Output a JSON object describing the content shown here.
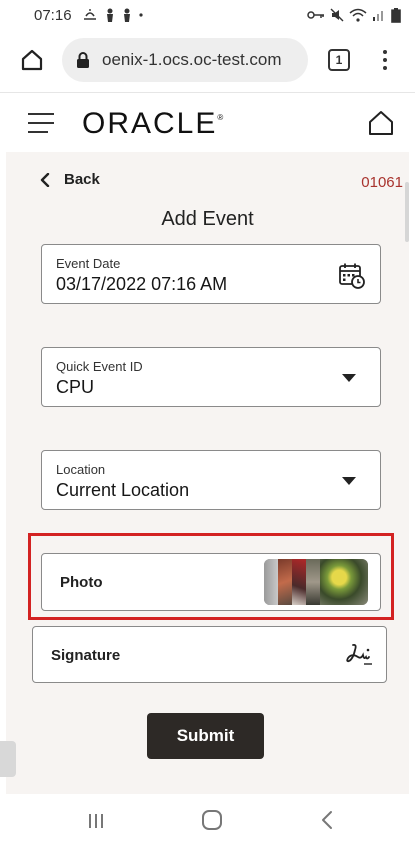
{
  "status_bar": {
    "time": "07:16",
    "left_icons": [
      "weather-icon",
      "notification-icon",
      "notification-icon",
      "dot-icon"
    ],
    "right_icons": [
      "vpn-key-icon",
      "mute-icon",
      "wifi-icon",
      "signal-icon",
      "battery-icon"
    ]
  },
  "browser": {
    "url": "oenix-1.ocs.oc-test.com",
    "tab_count": "1"
  },
  "app_header": {
    "logo": "ORACLE",
    "logo_mark": "®"
  },
  "page": {
    "back_label": "Back",
    "record_id": "01061",
    "title": "Add Event"
  },
  "form": {
    "event_date": {
      "label": "Event Date",
      "value": "03/17/2022 07:16 AM"
    },
    "quick_event_id": {
      "label": "Quick Event ID",
      "value": "CPU"
    },
    "location": {
      "label": "Location",
      "value": "Current Location"
    },
    "photo": {
      "label": "Photo"
    },
    "signature": {
      "label": "Signature"
    },
    "submit_label": "Submit"
  },
  "colors": {
    "accent_red": "#a8322d",
    "highlight_red": "#d32222",
    "submit_bg": "#2d2926",
    "content_bg": "#f7f4f2"
  }
}
